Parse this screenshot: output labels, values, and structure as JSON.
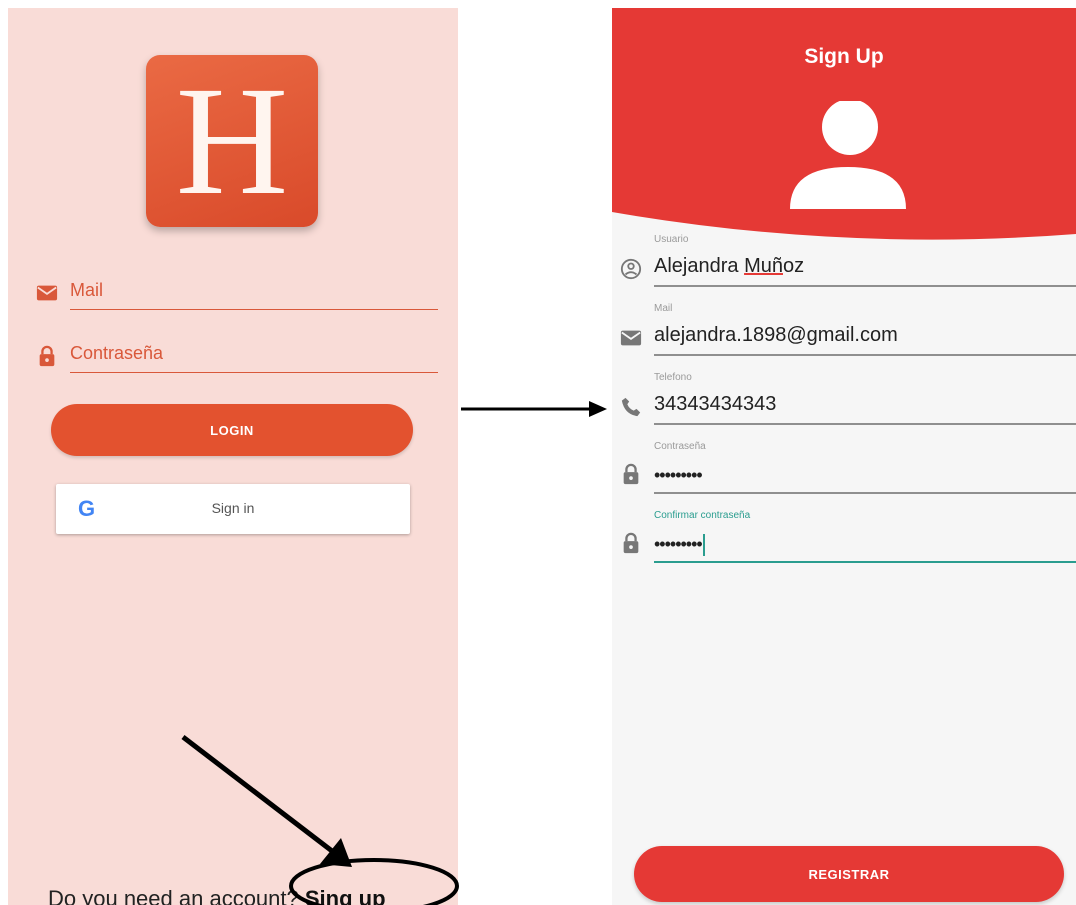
{
  "login": {
    "logo_letter": "H",
    "mail_placeholder": "Mail",
    "password_placeholder": "Contraseña",
    "login_button": "LOGIN",
    "google_g": "G",
    "google_button": "Sign in",
    "signup_question": "Do you need an account?",
    "signup_link": "Sing up"
  },
  "signup": {
    "title": "Sign Up",
    "fields": [
      {
        "label": "Usuario",
        "value_part1": "Alejandra ",
        "value_part2": "Muñoz",
        "value_part3": "oz",
        "icon": "account-circle-icon"
      },
      {
        "label": "Mail",
        "value": "alejandra.1898@gmail.com",
        "icon": "envelope-icon"
      },
      {
        "label": "Telefono",
        "value": "34343434343",
        "icon": "phone-icon"
      },
      {
        "label": "Contraseña",
        "value": "•••••••••",
        "icon": "lock-icon"
      },
      {
        "label": "Confirmar contraseña",
        "value": "•••••••••",
        "icon": "lock-icon"
      }
    ],
    "register_button": "REGISTRAR"
  },
  "colors": {
    "login_background": "#f9dcd7",
    "login_accent": "#e3522f",
    "signup_header": "#e53935",
    "signup_background": "#f6f6f6",
    "focus_accent": "#2a9d8f"
  }
}
